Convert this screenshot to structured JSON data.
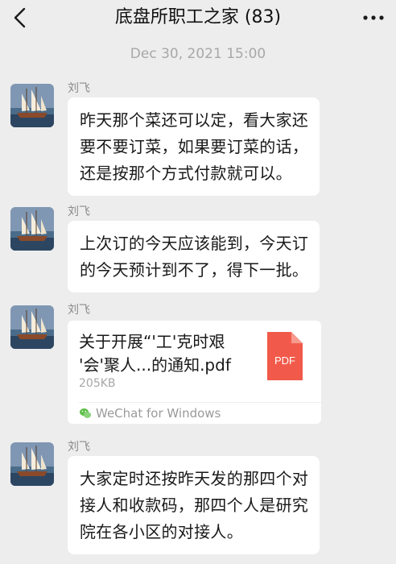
{
  "header": {
    "title": "底盘所职工之家 (83)",
    "back_icon": "chevron-left-icon",
    "more_icon": "more-dots-icon"
  },
  "timestamp": "Dec 30, 2021 15:00",
  "messages": [
    {
      "sender": "刘飞",
      "lines": [
        "昨天那个菜还可以定，看大家还",
        "要不要订菜，如果要订菜的话，",
        "还是按那个方式付款就可以。"
      ]
    },
    {
      "sender": "刘飞",
      "lines": [
        "上次订的今天应该能到，今天订",
        "的今天预计到不了，得下一批。"
      ]
    },
    {
      "sender": "刘飞",
      "file": {
        "name_lines": [
          "关于开展“'工'克时艰",
          "'会'聚人...的通知.pdf"
        ],
        "size": "205KB",
        "type_label": "PDF",
        "source": "WeChat for Windows"
      }
    },
    {
      "sender": "刘飞",
      "lines": [
        "大家定时还按昨天发的那四个对",
        "接人和收款码，那四个人是研究",
        "院在各小区的对接人。"
      ]
    }
  ]
}
